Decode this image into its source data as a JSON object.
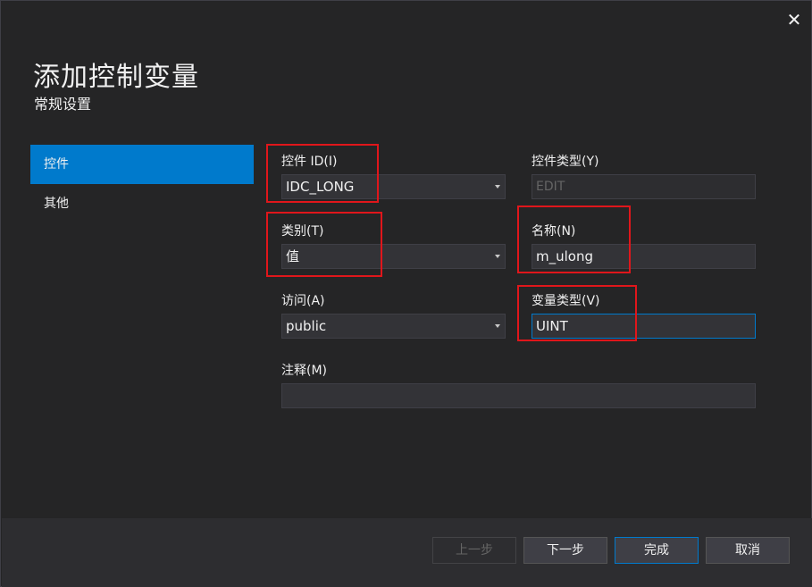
{
  "window": {
    "close_glyph": "✕"
  },
  "header": {
    "title": "添加控制变量",
    "subtitle": "常规设置"
  },
  "nav": {
    "items": [
      {
        "label": "控件",
        "active": true
      },
      {
        "label": "其他",
        "active": false
      }
    ]
  },
  "form": {
    "control_id": {
      "label": "控件 ID(I)",
      "value": "IDC_LONG"
    },
    "control_type": {
      "label": "控件类型(Y)",
      "value": "EDIT"
    },
    "category": {
      "label": "类别(T)",
      "value": "值"
    },
    "name": {
      "label": "名称(N)",
      "value": "m_ulong"
    },
    "access": {
      "label": "访问(A)",
      "value": "public"
    },
    "variable_type": {
      "label": "变量类型(V)",
      "value": "UINT"
    },
    "comment": {
      "label": "注释(M)",
      "value": ""
    }
  },
  "buttons": {
    "prev": "上一步",
    "next": "下一步",
    "finish": "完成",
    "cancel": "取消"
  },
  "colors": {
    "background": "#252526",
    "accent": "#007acc",
    "highlight_box": "#e0161b",
    "field_bg": "#333337"
  }
}
